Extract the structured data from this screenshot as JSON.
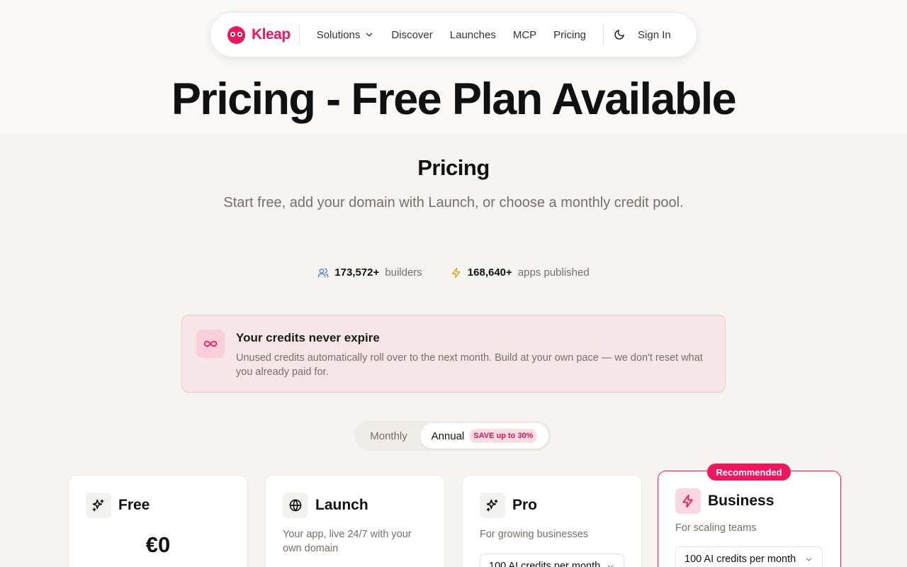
{
  "nav": {
    "brand": "Kleap",
    "links": [
      "Solutions",
      "Discover",
      "Launches",
      "MCP",
      "Pricing"
    ],
    "sign_in": "Sign In",
    "theme_icon": "moon-icon"
  },
  "hero": {
    "title": "Pricing - Free Plan Available"
  },
  "pricing": {
    "heading": "Pricing",
    "subtitle": "Start free, add your domain with Launch, or choose a monthly credit pool."
  },
  "stats": [
    {
      "value": "173,572+",
      "label": "builders",
      "icon": "users-icon",
      "color": "#4a7fd6"
    },
    {
      "value": "168,640+",
      "label": "apps published",
      "icon": "bolt-icon",
      "color": "#e5a210"
    }
  ],
  "banner": {
    "title": "Your credits never expire",
    "text": "Unused credits automatically roll over to the next month. Build at your own pace — we don't reset what you already paid for.",
    "icon": "infinity-icon"
  },
  "billing_toggle": {
    "monthly": "Monthly",
    "annual": "Annual",
    "annual_badge": "SAVE up to 30%",
    "selected": "Annual"
  },
  "plans": [
    {
      "name": "Free",
      "price": "€0",
      "icon": "sparkles-icon"
    },
    {
      "name": "Launch",
      "description": "Your app, live 24/7 with your own domain",
      "icon": "globe-icon"
    },
    {
      "name": "Pro",
      "description": "For growing businesses",
      "credits_option": "100 AI credits per month",
      "icon": "sparkles-icon"
    },
    {
      "name": "Business",
      "description": "For scaling teams",
      "credits_option": "100 AI credits per month",
      "badge": "Recommended",
      "icon": "bolt-icon"
    }
  ],
  "colors": {
    "accent": "#f0155c",
    "muted_text": "#7a6e66",
    "background": "#f6f4f1"
  }
}
